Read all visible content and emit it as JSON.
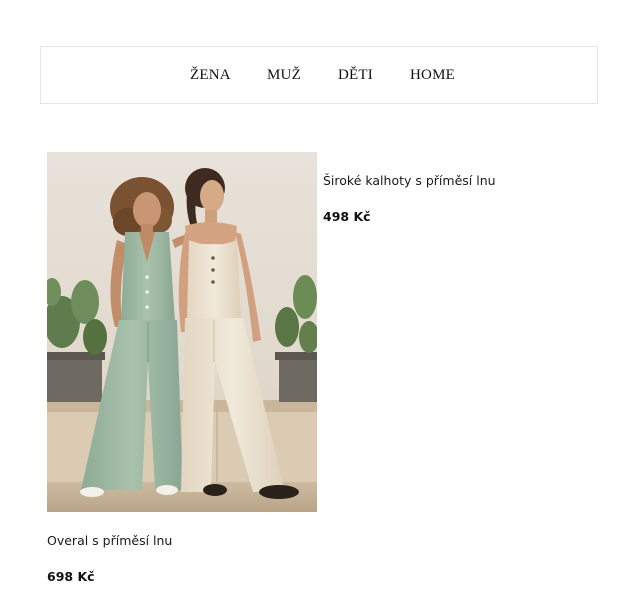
{
  "nav": {
    "items": [
      {
        "label": "ŽENA"
      },
      {
        "label": "MUŽ"
      },
      {
        "label": "DĚTI"
      },
      {
        "label": "HOME"
      }
    ]
  },
  "products": [
    {
      "name": "Široké kalhoty s příměsí lnu",
      "price": "498 Kč"
    },
    {
      "name": "Overal s příměsí lnu",
      "price": "698 Kč"
    }
  ],
  "colors": {
    "border": "#e6e6e6",
    "wall": "#e9e4dc",
    "green_suit": "#9db7a3",
    "cream_jumpsuit": "#ece3d2"
  }
}
